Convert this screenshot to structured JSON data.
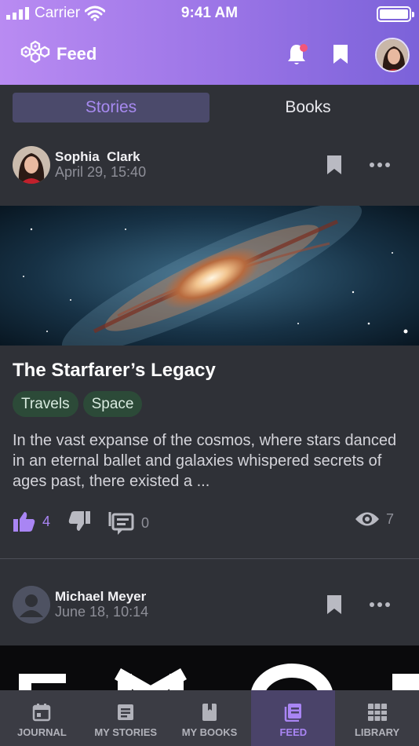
{
  "status_bar": {
    "carrier": "Carrier",
    "time": "9:41 AM"
  },
  "app_bar": {
    "title": "Feed",
    "icons": [
      "logo-hexagons",
      "bell-icon",
      "bookmark-icon",
      "profile-avatar"
    ],
    "notification_dot": true
  },
  "tabs": [
    {
      "label": "Stories",
      "active": true
    },
    {
      "label": "Books",
      "active": false
    }
  ],
  "posts": [
    {
      "author": "Sophia  Clark",
      "date": "April 29, 15:40",
      "title": "The Starfarer’s Legacy",
      "tags": [
        "Travels",
        "Space"
      ],
      "excerpt": "In the vast expanse of the cosmos, where stars danced in an eternal ballet and galaxies whispered secrets of ages past, there existed a ...",
      "likes": "4",
      "comments": "0",
      "views": "7"
    },
    {
      "author": "Michael Meyer",
      "date": "June 18, 10:14"
    }
  ],
  "bottom_nav": [
    {
      "label": "JOURNAL",
      "icon": "calendar-icon",
      "active": false
    },
    {
      "label": "MY STORIES",
      "icon": "story-icon",
      "active": false
    },
    {
      "label": "MY BOOKS",
      "icon": "book-icon",
      "active": false
    },
    {
      "label": "FEED",
      "icon": "feed-icon",
      "active": true
    },
    {
      "label": "LIBRARY",
      "icon": "library-icon",
      "active": false
    }
  ],
  "colors": {
    "accent": "#a985f4",
    "background": "#2f3137",
    "tag_bg": "#2c4a38",
    "header_start": "#b98bf2",
    "header_end": "#7b62d9"
  }
}
